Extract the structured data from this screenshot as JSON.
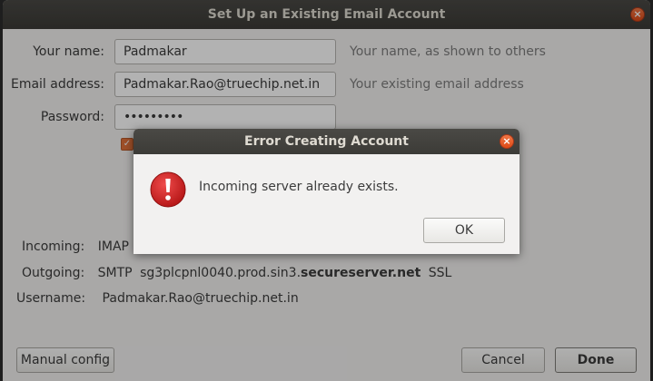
{
  "window": {
    "title": "Set Up an Existing Email Account",
    "close_glyph": "×"
  },
  "form": {
    "name_label": "Your name:",
    "name_value": "Padmakar",
    "name_hint": "Your name, as shown to others",
    "email_label": "Email address:",
    "email_value": "Padmakar.Rao@truechip.net.in",
    "email_hint": "Your existing email address",
    "password_label": "Password:",
    "password_value": "•••••••••",
    "remember_checked_glyph": "✓"
  },
  "server_info": {
    "incoming_label": "Incoming:",
    "incoming_value": "IMAP s",
    "outgoing_label": "Outgoing:",
    "outgoing_protocol": "SMTP",
    "outgoing_host_prefix": "sg3plcpnl0040.prod.sin3.",
    "outgoing_host_domain": "secureserver.net",
    "outgoing_security": "SSL",
    "username_label": "Username:",
    "username_value": "Padmakar.Rao@truechip.net.in"
  },
  "buttons": {
    "manual_config": "Manual config",
    "cancel": "Cancel",
    "done": "Done"
  },
  "dialog": {
    "title": "Error Creating Account",
    "message": "Incoming server already exists.",
    "ok": "OK",
    "close_glyph": "×"
  },
  "colors": {
    "titlebar": "#3c3b37",
    "accent_close": "#df4a16",
    "checkbox": "#e2713a",
    "error_icon": "#cc1f1f"
  }
}
